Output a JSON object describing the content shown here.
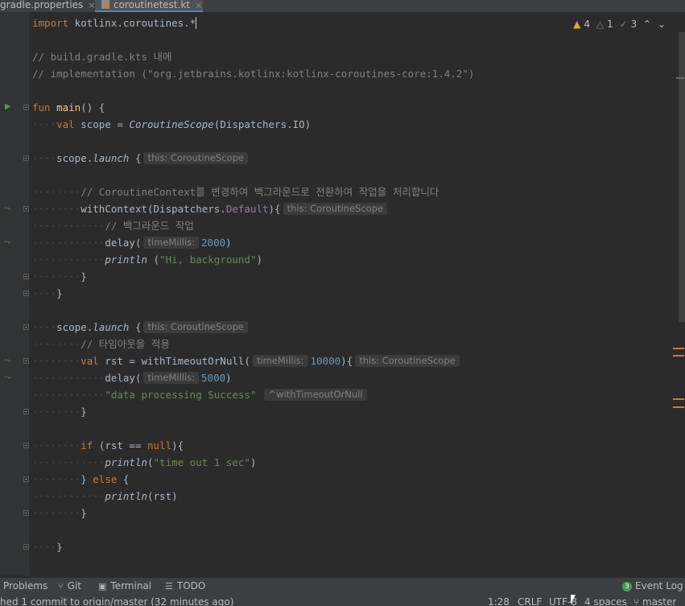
{
  "tabs": [
    {
      "label": "gradle.properties",
      "close": "×"
    },
    {
      "label": "coroutinetest.kt",
      "close": "×"
    }
  ],
  "inspections": {
    "warnings": "4",
    "weak": "1",
    "ok": "3"
  },
  "code": {
    "l1_import": "import",
    "l1_rest": " kotlinx.coroutines.*",
    "l3": "// build.gradle.kts 내에",
    "l4": "// implementation (\"org.jetbrains.kotlinx:kotlinx-coroutines-core:1.4.2\")",
    "l6_fun": "fun",
    "l6_name": "main",
    "l6_rest": "() {",
    "l7_val": "val",
    "l7_a": " scope = ",
    "l7_b": "CoroutineScope",
    "l7_c": "(Dispatchers.IO)",
    "l9_a": "scope.",
    "l9_b": "launch",
    "l9_c": " {",
    "hint_this": "this: CoroutineScope",
    "l11": "// CoroutineContext를 변경하여 백그라운드로 전환하여 작업을 처리합니다",
    "l12_a": "withContext(Dispatchers.",
    "l12_b": "Default",
    "l12_c": "){",
    "l13": "// 백그라운드 작업",
    "l14_a": "delay(",
    "hint_time": "timeMillis:",
    "l14_n": "2000",
    "l14_c": ")",
    "l15_a": "println",
    "l15_b": " (",
    "l15_s": "\"Hi, background\"",
    "l15_c": ")",
    "close_brace": "}",
    "l19_cm": "// 타임아웃을 적용",
    "l20_val": "val",
    "l20_a": " rst = withTimeoutOrNull(",
    "l20_n": "10000",
    "l20_c": "){",
    "l21_n": "5000",
    "l22_s": "\"data processing Success\"",
    "hint_ret": "^withTimeoutOrNull",
    "l25_if": "if",
    "l25_a": " (rst == ",
    "l25_null": "null",
    "l25_b": "){",
    "l26_s": "\"time out 1 sec\"",
    "l26_a": "println",
    "l26_b": "(",
    "l26_c": ")",
    "l27_a": "} ",
    "l27_else": "else",
    "l27_b": " {",
    "l28_b": "(rst)"
  },
  "toolwindows": {
    "problems": "Problems",
    "git": "Git",
    "terminal": "Terminal",
    "todo": "TODO",
    "eventlog": "Event Log",
    "eventlog_count": "3"
  },
  "status": {
    "message": "hed 1 commit to origin/master (32 minutes ago)",
    "position": "1:28",
    "line_sep": "CRLF",
    "encoding": "UTF-8",
    "indent": "4 spaces",
    "branch": "master"
  },
  "colors": {
    "accent": "#4a88c7",
    "keyword": "#cc7832",
    "string": "#6a8759",
    "number": "#6897bb",
    "function": "#ffc66d"
  }
}
